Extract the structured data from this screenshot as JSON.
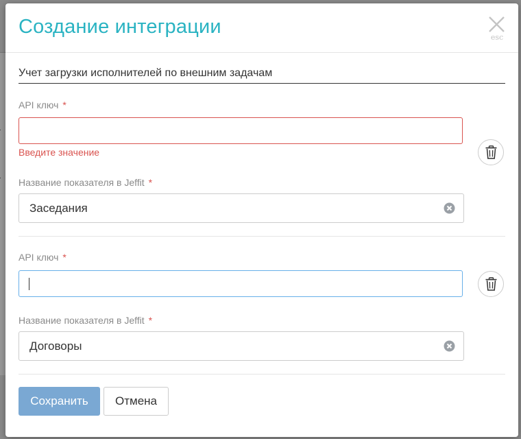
{
  "background": {
    "fragments": [
      "с",
      "а",
      "а",
      "й"
    ]
  },
  "modal": {
    "title": "Создание интеграции",
    "close_hint": "esc",
    "integration_name": "Учет загрузки исполнителей по внешним задачам"
  },
  "groups": [
    {
      "api_key_label": "API ключ",
      "api_key_value": "",
      "api_key_error": "Введите значение",
      "metric_label": "Название показателя в Jeffit",
      "metric_value": "Заседания"
    },
    {
      "api_key_label": "API ключ",
      "api_key_value": "",
      "metric_label": "Название показателя в Jeffit",
      "metric_value": "Договоры"
    }
  ],
  "required_mark": "*",
  "buttons": {
    "save": "Сохранить",
    "cancel": "Отмена"
  },
  "colors": {
    "title": "#2ab3c2",
    "error": "#d9534f",
    "save_button": "#7aa8d3",
    "focus_border": "#66afe9"
  },
  "icons": {
    "close": "close-icon",
    "delete": "trash-icon",
    "clear": "clear-circle-icon"
  }
}
